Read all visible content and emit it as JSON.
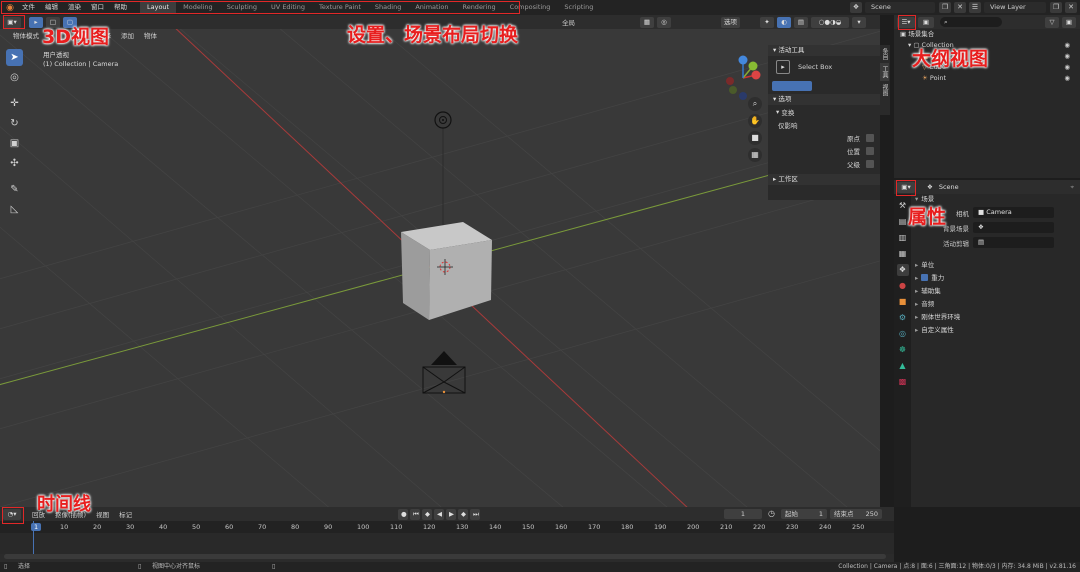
{
  "menu": {
    "items": [
      "文件",
      "编辑",
      "渲染",
      "窗口",
      "帮助"
    ]
  },
  "workspaces": {
    "tabs": [
      "Layout",
      "Modeling",
      "Sculpting",
      "UV Editing",
      "Texture Paint",
      "Shading",
      "Animation",
      "Rendering",
      "Compositing",
      "Scripting"
    ],
    "active": "Layout"
  },
  "scene": {
    "name": "Scene",
    "view_layer": "View Layer"
  },
  "viewport": {
    "mode": "物体模式",
    "menus": [
      "视图",
      "选择",
      "添加",
      "物体"
    ],
    "transform_orientation": "全局",
    "options_label": "选项",
    "info_line1": "用户透视",
    "info_line2": "(1) Collection | Camera"
  },
  "npanel": {
    "active_tool_title": "活动工具",
    "select_box": "Select Box",
    "options_title": "选项",
    "transform_title": "变换",
    "affect_only": "仅影响",
    "origins": "原点",
    "locations": "位置",
    "parents": "父级",
    "workspace_title": "工作区",
    "tabs": [
      "条目",
      "工具",
      "视图"
    ]
  },
  "outliner": {
    "root": "场景集合",
    "collection": "Collection",
    "items": [
      "Camera",
      "Cube",
      "Point"
    ]
  },
  "properties": {
    "scene_name": "Scene",
    "section_scene": "场景",
    "camera_label": "相机",
    "camera_value": "Camera",
    "bg_scene_label": "背景场景",
    "active_clip_label": "活动剪辑",
    "sections": [
      "单位",
      "重力",
      "辅助集",
      "音频",
      "刚体世界环境",
      "自定义属性"
    ],
    "gravity_checked": true
  },
  "timeline": {
    "menus": [
      "回放",
      "抠像(插帧)",
      "视图",
      "标记"
    ],
    "current_frame": "1",
    "start_label": "起始",
    "start_value": "1",
    "end_label": "结束点",
    "end_value": "250",
    "ruler": [
      "1",
      "10",
      "20",
      "30",
      "40",
      "50",
      "60",
      "70",
      "80",
      "90",
      "100",
      "110",
      "120",
      "130",
      "140",
      "150",
      "160",
      "170",
      "180",
      "190",
      "200",
      "210",
      "220",
      "230",
      "240",
      "250"
    ]
  },
  "statusbar": {
    "left": "选择",
    "middle": "视图中心对齐鼠标",
    "right": "Collection | Camera | 点:8 | 面:6 | 三角面:12 | 物体:0/3 | 内存: 34.8 MiB | v2.81.16"
  },
  "annotations": {
    "view3d": "3D视图",
    "settings": "设置、场景布局切换",
    "outliner": "大纲视图",
    "properties": "属性",
    "timeline": "时间线"
  },
  "colors": {
    "accent_blue": "#4772b3",
    "annotation_red": "#e12828",
    "x_axis": "#a83a3a",
    "y_axis": "#7a9a3a"
  }
}
